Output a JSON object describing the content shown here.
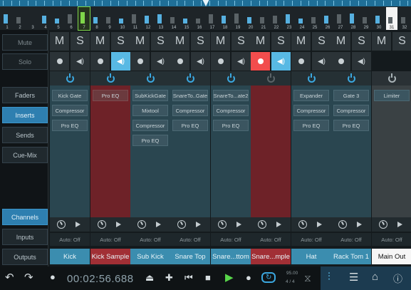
{
  "overview": {
    "numbers": [
      "1",
      "2",
      "3",
      "4",
      "5",
      "6",
      "7",
      "8",
      "9",
      "10",
      "11",
      "12",
      "13",
      "14",
      "15",
      "16",
      "17",
      "18",
      "19",
      "20",
      "21",
      "22",
      "23",
      "24",
      "25",
      "26",
      "27",
      "28",
      "29",
      "30",
      "31",
      "32"
    ]
  },
  "sidebar": {
    "mute_label": "Mute",
    "solo_label": "Solo",
    "faders_label": "Faders",
    "inserts_label": "Inserts",
    "sends_label": "Sends",
    "cuemix_label": "Cue-Mix",
    "channels_label": "Channels",
    "inputs_label": "Inputs",
    "outputs_label": "Outputs"
  },
  "strips": [
    {
      "name": "Kick",
      "m": "M",
      "s": "S",
      "auto": "Auto: Off",
      "inserts": [
        "Kick Gate",
        "Compressor",
        "Pro EQ"
      ],
      "armed": false,
      "monitor": false,
      "color": "teal"
    },
    {
      "name": "Kick Sample",
      "m": "M",
      "s": "S",
      "auto": "Auto: Off",
      "inserts": [
        "Pro EQ"
      ],
      "armed": false,
      "monitor": true,
      "color": "red"
    },
    {
      "name": "Sub Kick",
      "m": "M",
      "s": "S",
      "auto": "Auto: Off",
      "inserts": [
        "SubKickGate",
        "Mixtool",
        "Compressor",
        "Pro EQ"
      ],
      "armed": false,
      "monitor": false,
      "color": "teal"
    },
    {
      "name": "Snare Top",
      "m": "M",
      "s": "S",
      "auto": "Auto: Off",
      "inserts": [
        "SnareTo..Gate",
        "Compressor",
        "Pro EQ"
      ],
      "armed": false,
      "monitor": false,
      "color": "teal"
    },
    {
      "name": "Snare...ttom",
      "m": "M",
      "s": "S",
      "auto": "Auto: Off",
      "inserts": [
        "SnareTo...ate2",
        "Compressor",
        "Pro EQ"
      ],
      "armed": false,
      "monitor": false,
      "color": "teal"
    },
    {
      "name": "Snare...mple",
      "m": "M",
      "s": "S",
      "auto": "Auto: Off",
      "inserts": [],
      "armed": true,
      "monitor": true,
      "color": "red"
    },
    {
      "name": "Hat",
      "m": "M",
      "s": "S",
      "auto": "Auto: Off",
      "inserts": [
        "Expander",
        "Compressor",
        "Pro EQ"
      ],
      "armed": false,
      "monitor": false,
      "color": "teal"
    },
    {
      "name": "Rack Tom 1",
      "m": "M",
      "s": "S",
      "auto": "Auto: Off",
      "inserts": [
        "Gate 3",
        "Compressor",
        "Pro EQ"
      ],
      "armed": false,
      "monitor": false,
      "color": "teal"
    },
    {
      "name": "Main Out",
      "m": "M",
      "s": "S",
      "auto": "Auto: Off",
      "inserts": [
        "Limiter"
      ],
      "armed": false,
      "monitor": false,
      "color": "master"
    }
  ],
  "transport": {
    "time": "00:02:56.688",
    "tempo": "95.00",
    "signature": "4 / 4"
  },
  "colors": {
    "accent": "#3b8daf",
    "record": "#f24d4d",
    "monitor": "#58b9e4",
    "play": "#58d64a"
  }
}
